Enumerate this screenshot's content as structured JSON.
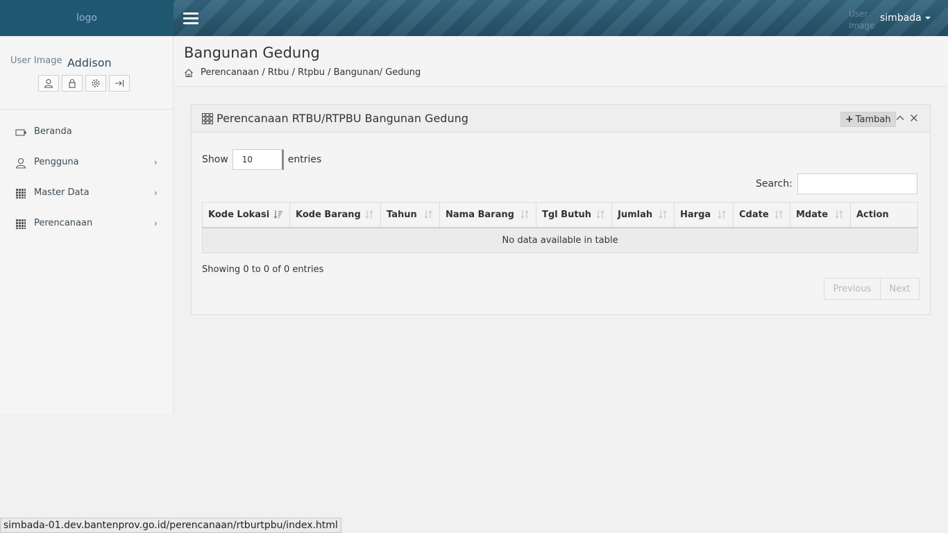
{
  "topbar": {
    "logo_alt": "logo",
    "user_image_alt": "User Image",
    "username": "simbada"
  },
  "sidebar": {
    "profile_image_alt": "User Image",
    "profile_name": "Addison",
    "actions": [
      "profile-icon",
      "lock-icon",
      "gear-icon",
      "logout-icon"
    ],
    "items": [
      {
        "label": "Beranda",
        "icon": "home-icon"
      },
      {
        "label": "Pengguna",
        "icon": "user-icon"
      },
      {
        "label": "Master Data",
        "icon": "grid-icon"
      },
      {
        "label": "Perencanaan",
        "icon": "grid-icon"
      }
    ]
  },
  "header": {
    "title": "Bangunan Gedung",
    "breadcrumb": "Perencanaan / Rtbu / Rtpbu /  Bangunan/ Gedung"
  },
  "panel": {
    "title": "Perencanaan RTBU/RTPBU Bangunan Gedung",
    "add_label": "Tambah",
    "show_label": "Show",
    "entries_label": "entries",
    "length_value": "10",
    "search_label": "Search:",
    "search_value": "",
    "columns": [
      "Kode Lokasi",
      "Kode Barang",
      "Tahun",
      "Nama Barang",
      "Tgl Butuh",
      "Jumlah",
      "Harga",
      "Cdate",
      "Mdate",
      "Action"
    ],
    "empty_message": "No data available in table",
    "info": "Showing 0 to 0 of 0 entries",
    "prev_label": "Previous",
    "next_label": "Next"
  },
  "status_url": "simbada-01.dev.bantenprov.go.id/perencanaan/rtburtpbu/index.html"
}
